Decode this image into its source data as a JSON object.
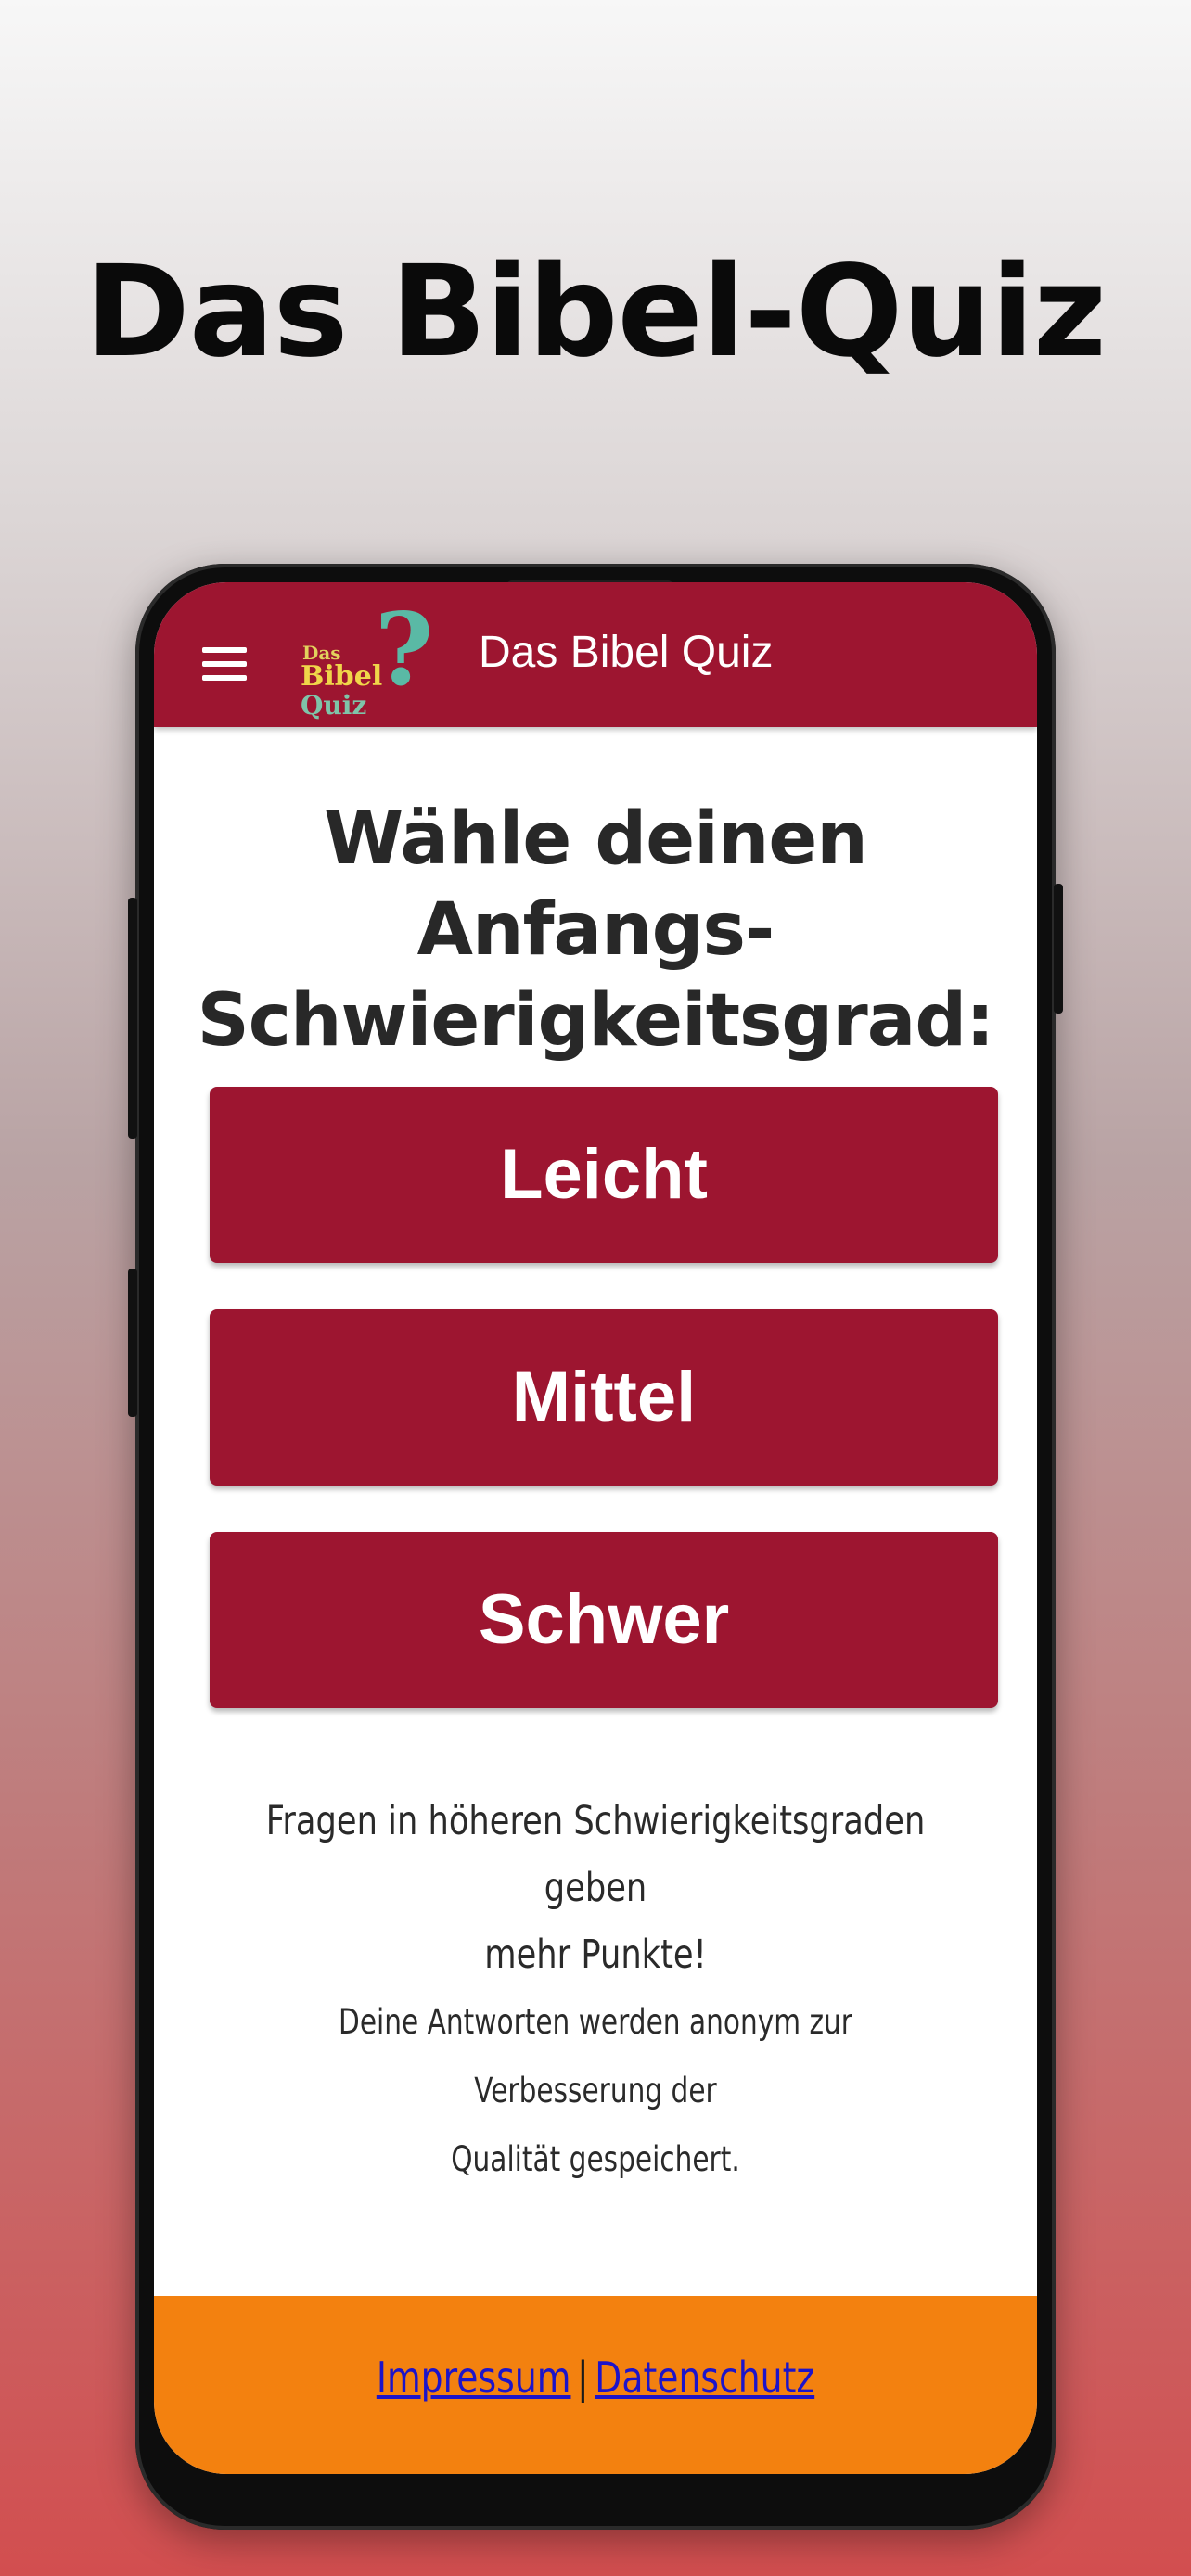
{
  "promo": {
    "title": "Das Bibel-Quiz"
  },
  "appbar": {
    "title": "Das Bibel Quiz",
    "logo": {
      "line1": "Das",
      "line2": "Bibel",
      "line3": "Quiz",
      "mark": "?"
    }
  },
  "main": {
    "heading_line1": "Wähle deinen Anfangs-",
    "heading_line2": "Schwierigkeitsgrad:",
    "levels": [
      {
        "label": "Leicht"
      },
      {
        "label": "Mittel"
      },
      {
        "label": "Schwer"
      }
    ],
    "note_points_line1": "Fragen in höheren Schwierigkeitsgraden geben",
    "note_points_line2": "mehr Punkte!",
    "note_privacy_line1": "Deine Antworten werden anonym zur Verbesserung der",
    "note_privacy_line2": "Qualität gespeichert."
  },
  "footer": {
    "impressum": "Impressum",
    "separator": "|",
    "datenschutz": "Datenschutz"
  },
  "colors": {
    "primary": "#9d1530",
    "footer": "#f3810f",
    "link": "#1d14c9"
  }
}
